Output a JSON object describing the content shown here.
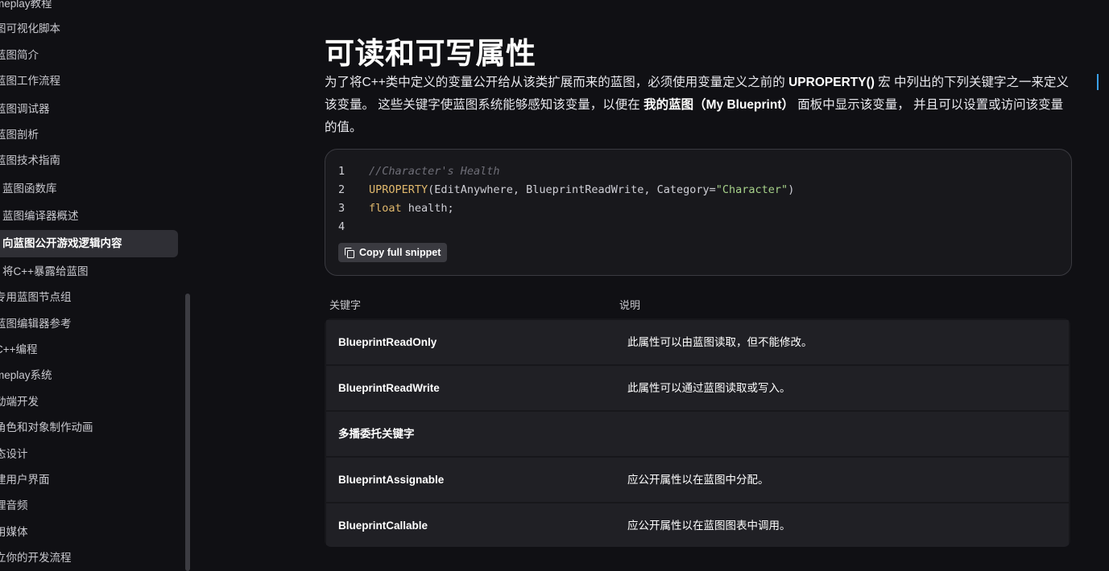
{
  "sidebar": {
    "items": [
      {
        "label": "meplay教程"
      },
      {
        "label": "图可视化脚本"
      },
      {
        "label": "蓝图简介"
      },
      {
        "label": "蓝图工作流程"
      },
      {
        "label": "蓝图调试器"
      },
      {
        "label": "蓝图剖析"
      },
      {
        "label": "蓝图技术指南"
      },
      {
        "label": "蓝图函数库"
      },
      {
        "label": "蓝图编译器概述"
      },
      {
        "label": "向蓝图公开游戏逻辑内容"
      },
      {
        "label": "将C++暴露给蓝图"
      },
      {
        "label": "专用蓝图节点组"
      },
      {
        "label": "蓝图编辑器参考"
      },
      {
        "label": "C++编程"
      },
      {
        "label": "meplay系统"
      },
      {
        "label": "动端开发"
      },
      {
        "label": "角色和对象制作动画"
      },
      {
        "label": "态设计"
      },
      {
        "label": "建用户界面"
      },
      {
        "label": "理音频"
      },
      {
        "label": "用媒体"
      },
      {
        "label": "立你的开发流程"
      }
    ],
    "active_index": 9
  },
  "main": {
    "title": "可读和可写属性",
    "intro": {
      "p1": "为了将C++类中定义的变量公开给从该类扩展而来的蓝图，必须使用变量定义之前的 ",
      "b1": "UPROPERTY()",
      "p2": " 宏 中列出的下列关键字之一来定义该变量。 这些关键字使蓝图系统能够感知该变量，以便在 ",
      "b2": "我的蓝图（My Blueprint）",
      "p3": " 面板中显示该变量， 并且可以设置或访问该变量的值。"
    },
    "code": {
      "line_numbers": [
        "1",
        "2",
        "3",
        "4"
      ],
      "comment": "//Character's Health",
      "macro": "UPROPERTY",
      "args_open": "(EditAnywhere, BlueprintReadWrite, Category=",
      "string": "\"Character\"",
      "args_close": ")",
      "type_kw": "float",
      "decl": " health;",
      "copy_label": "Copy full snippet"
    },
    "table": {
      "headers": [
        "关键字",
        "说明"
      ],
      "rows": [
        {
          "key": "BlueprintReadOnly",
          "desc": "此属性可以由蓝图读取，但不能修改。"
        },
        {
          "key": "BlueprintReadWrite",
          "desc": "此属性可以通过蓝图读取或写入。"
        },
        {
          "key": "多播委托关键字",
          "desc": ""
        },
        {
          "key": "BlueprintAssignable",
          "desc": "应公开属性以在蓝图中分配。"
        },
        {
          "key": "BlueprintCallable",
          "desc": "应公开属性以在蓝图图表中调用。"
        }
      ]
    }
  },
  "colors": {
    "background": "#101014",
    "code_string": "#a6d189",
    "code_macro": "#e0b86c",
    "accent_marker": "#3aa0e8"
  }
}
